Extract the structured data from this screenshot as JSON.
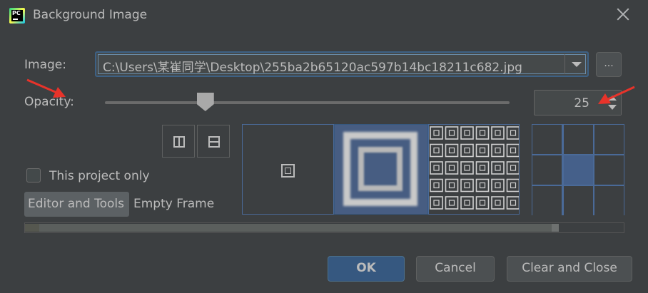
{
  "window": {
    "title": "Background Image",
    "app_icon_label": "PC"
  },
  "image_field": {
    "label": "Image:",
    "value": "C:\\Users\\某崔同学\\Desktop\\255ba2b65120ac597b14bc18211c682.jpg",
    "browse_label": "..."
  },
  "opacity": {
    "label": "Opacity:",
    "value": "25",
    "slider_fraction": 0.25
  },
  "options": {
    "this_project_only_label": "This project only",
    "this_project_only_checked": false
  },
  "target_tabs": [
    {
      "label": "Editor and Tools",
      "selected": true
    },
    {
      "label": "Empty Frame",
      "selected": false
    }
  ],
  "fill_modes": [
    "plain",
    "scale",
    "center",
    "tile"
  ],
  "anchor_grid": {
    "selected_row": 1,
    "selected_col": 1
  },
  "buttons": {
    "ok": "OK",
    "cancel": "Cancel",
    "clear_and_close": "Clear and Close"
  },
  "colors": {
    "background": "#3c3f41",
    "accent": "#365880",
    "annotation_arrow": "#e8332a",
    "panel_border": "#4a6a98"
  }
}
